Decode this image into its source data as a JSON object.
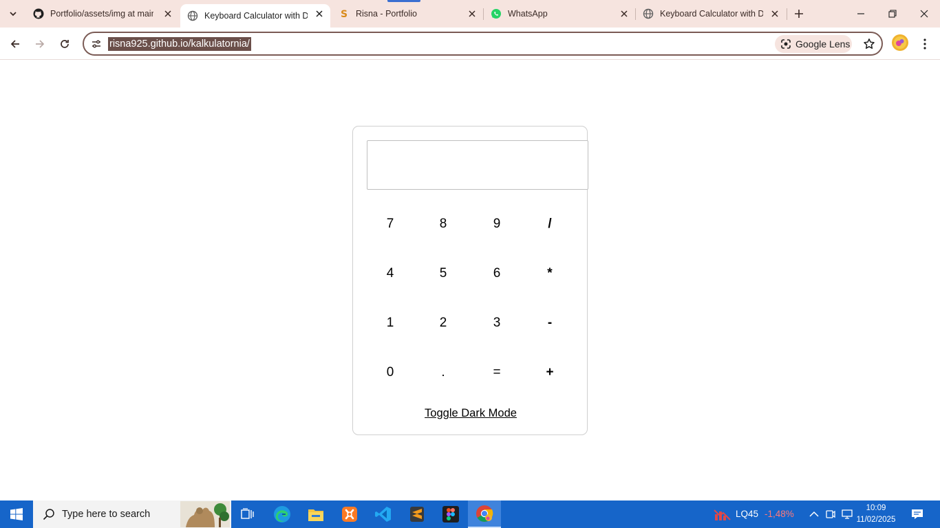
{
  "browser": {
    "tabs": [
      {
        "title": "Portfolio/assets/img at main",
        "favicon": "github-icon",
        "active": false
      },
      {
        "title": "Keyboard Calculator with Da",
        "favicon": "globe-icon",
        "active": true
      },
      {
        "title": "Risna - Portfolio",
        "favicon": "sublime-s-icon",
        "active": false
      },
      {
        "title": "WhatsApp",
        "favicon": "whatsapp-icon",
        "active": false
      },
      {
        "title": "Keyboard Calculator with Da",
        "favicon": "globe-icon",
        "active": false
      }
    ],
    "url": "risna925.github.io/kalkulatornia/",
    "lens_label": "Google Lens",
    "accent_color": "#f6e4df"
  },
  "calculator": {
    "display_value": "",
    "keys": [
      "7",
      "8",
      "9",
      "/",
      "4",
      "5",
      "6",
      "*",
      "1",
      "2",
      "3",
      "-",
      "0",
      ".",
      "=",
      "+"
    ],
    "toggle_label": "Toggle Dark Mode"
  },
  "taskbar": {
    "search_placeholder": "Type here to search",
    "apps": [
      "task-view-icon",
      "edge-icon",
      "file-explorer-icon",
      "xampp-icon",
      "vscode-icon",
      "sublime-text-icon",
      "figma-icon",
      "chrome-icon"
    ],
    "stock_name": "LQ45",
    "stock_change": "-1,48%",
    "time": "10:09",
    "date": "11/02/2025",
    "color": "#1665c9"
  }
}
